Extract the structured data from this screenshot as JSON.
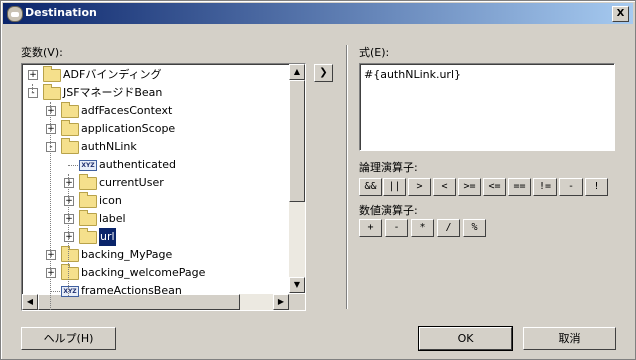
{
  "window": {
    "title": "Destination",
    "close_label": "X"
  },
  "variables": {
    "label": "変数(V):",
    "tree": [
      {
        "label": "ADFバインディング",
        "icon": "folder",
        "expander": "+"
      },
      {
        "label": "JSFマネージドBean",
        "icon": "folder",
        "expander": "-"
      },
      {
        "label": "adfFacesContext",
        "icon": "folder",
        "expander": "+"
      },
      {
        "label": "applicationScope",
        "icon": "folder",
        "expander": "+"
      },
      {
        "label": "authNLink",
        "icon": "folder",
        "expander": "-"
      },
      {
        "label": "authenticated",
        "icon": "xyz",
        "expander": ""
      },
      {
        "label": "currentUser",
        "icon": "folder",
        "expander": "+"
      },
      {
        "label": "icon",
        "icon": "folder",
        "expander": "+"
      },
      {
        "label": "label",
        "icon": "folder",
        "expander": "+"
      },
      {
        "label": "url",
        "icon": "folder",
        "expander": "+",
        "selected": true
      },
      {
        "label": "backing_MyPage",
        "icon": "folder",
        "expander": "+"
      },
      {
        "label": "backing_welcomePage",
        "icon": "folder",
        "expander": "+"
      },
      {
        "label": "frameActionsBean",
        "icon": "xyz",
        "expander": ""
      }
    ]
  },
  "expression": {
    "label": "式(E):",
    "value": "#{authNLink.url}"
  },
  "logical_ops": {
    "label": "論理演算子:",
    "buttons": [
      "&&",
      "||",
      ">",
      "<",
      ">=",
      "<=",
      "==",
      "!=",
      "-",
      "!"
    ]
  },
  "numeric_ops": {
    "label": "数値演算子:",
    "buttons": [
      "+",
      "-",
      "*",
      "/",
      "%"
    ]
  },
  "footer": {
    "help": "ヘルプ(H)",
    "ok": "OK",
    "cancel": "取消"
  },
  "icon_glyphs": {
    "xyz": "XYZ",
    "move_right": "❯",
    "scroll_up": "▲",
    "scroll_down": "▼",
    "scroll_left": "◀",
    "scroll_right": "▶"
  },
  "colors": {
    "title_start": "#0a246a",
    "title_end": "#a6caf0",
    "selection": "#0a246a",
    "dialog_bg": "#d4d0c8"
  }
}
